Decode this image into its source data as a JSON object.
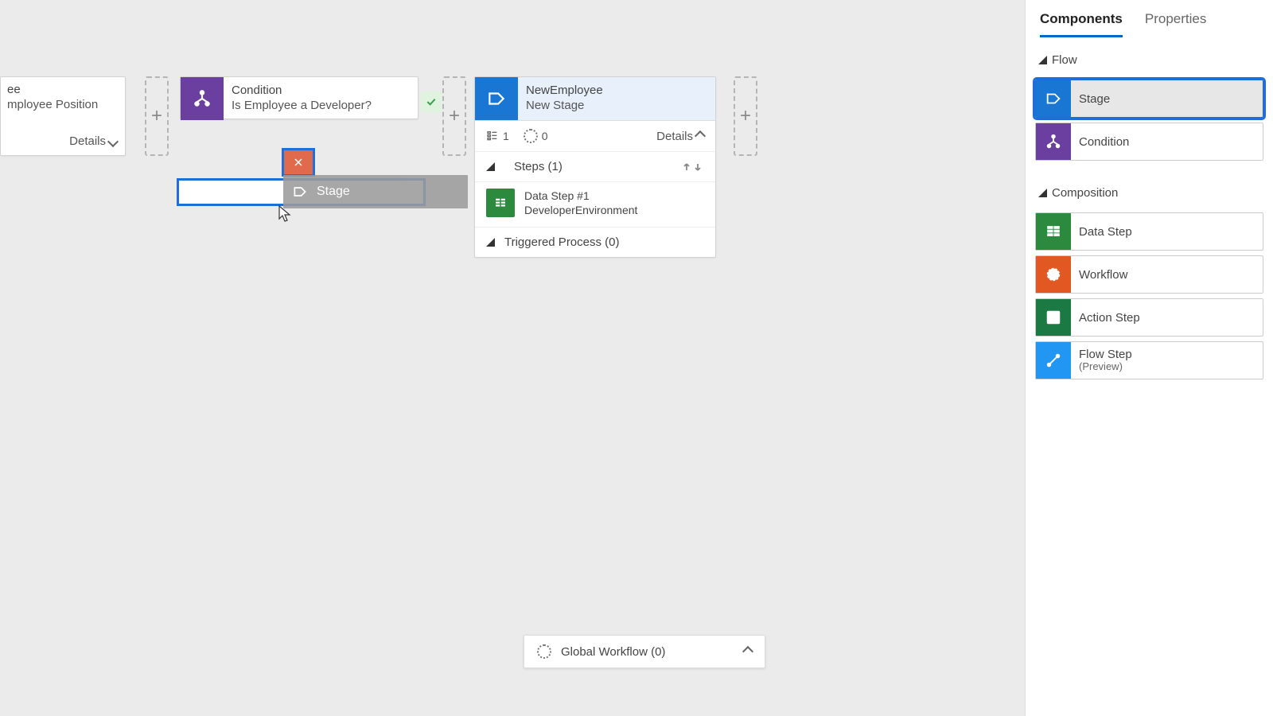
{
  "toolbar": {
    "zoomOut": "zoom-out",
    "zoomIn": "zoom-in",
    "fit": "fit-screen"
  },
  "rightPanel": {
    "tabs": {
      "components": "Components",
      "properties": "Properties"
    },
    "sections": {
      "flow": "Flow",
      "composition": "Composition"
    },
    "items": {
      "stage": "Stage",
      "condition": "Condition",
      "dataStep": "Data Step",
      "workflow": "Workflow",
      "actionStep": "Action Step",
      "flowStep": "Flow Step",
      "flowStepSub": "(Preview)"
    }
  },
  "canvas": {
    "partialStage": {
      "line1": "ee",
      "line2": "mployee Position",
      "details": "Details"
    },
    "condition": {
      "title": "Condition",
      "text": "Is Employee a Developer?"
    },
    "newStage": {
      "title": "NewEmployee",
      "sub": "New Stage",
      "stepsCount": "1",
      "wfCount": "0",
      "details": "Details",
      "stepsHeader": "Steps (1)",
      "dataStepTitle": "Data Step #1",
      "dataStepField": "DeveloperEnvironment",
      "triggered": "Triggered Process (0)"
    },
    "ghost": {
      "label": "Stage"
    },
    "globalWorkflow": "Global Workflow (0)"
  }
}
